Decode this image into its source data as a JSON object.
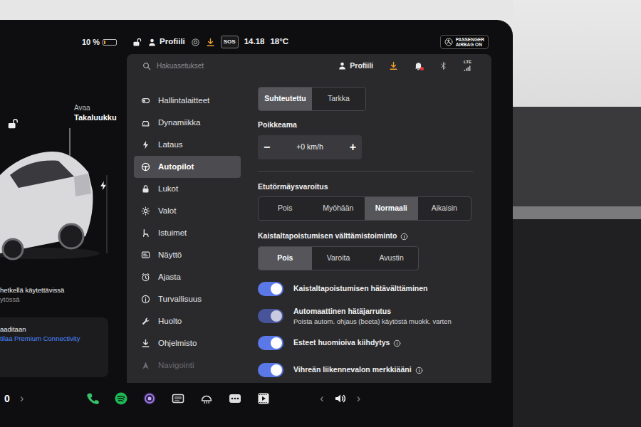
{
  "status_bar": {
    "battery": "10 %",
    "battery_level": 0.1,
    "profile": "Profiili",
    "sos": "SOS",
    "time": "14.18",
    "temperature": "18°C",
    "airbag": {
      "top": "PASSENGER",
      "bottom": "AIRBAG ON"
    }
  },
  "car_panel": {
    "trunk": {
      "top": "Avaa",
      "bottom": "Takaluukku"
    },
    "status": [
      "hetkellä käytettävissä",
      "ytössä"
    ],
    "connectivity": {
      "text": "aaditaan",
      "link": "tilaa Premium Connectivity"
    }
  },
  "settings": {
    "search": {
      "placeholder": "Hakuasetukset"
    },
    "profile": "Profiili",
    "unread": true,
    "network": "LTE",
    "nav": [
      {
        "label": "Hallintalaitteet",
        "selected": false,
        "dimmed": false
      },
      {
        "label": "Dynamiikka",
        "selected": false,
        "dimmed": false
      },
      {
        "label": "Lataus",
        "selected": false,
        "dimmed": false
      },
      {
        "label": "Autopilot",
        "selected": true,
        "dimmed": false
      },
      {
        "label": "Lukot",
        "selected": false,
        "dimmed": false
      },
      {
        "label": "Valot",
        "selected": false,
        "dimmed": false
      },
      {
        "label": "Istuimet",
        "selected": false,
        "dimmed": false
      },
      {
        "label": "Näyttö",
        "selected": false,
        "dimmed": false
      },
      {
        "label": "Ajasta",
        "selected": false,
        "dimmed": false
      },
      {
        "label": "Turvallisuus",
        "selected": false,
        "dimmed": false
      },
      {
        "label": "Huolto",
        "selected": false,
        "dimmed": false
      },
      {
        "label": "Ohjelmisto",
        "selected": false,
        "dimmed": false
      },
      {
        "label": "Navigointi",
        "selected": false,
        "dimmed": true
      }
    ],
    "steering_mode": {
      "options": [
        {
          "label": "Suhteutettu",
          "selected": true
        },
        {
          "label": "Tarkka",
          "selected": false
        }
      ]
    },
    "offset": {
      "label": "Poikkeama",
      "value": "+0 km/h",
      "decrease": "−",
      "increase": "+"
    },
    "forward_collision": {
      "label": "Etutörmäysvaroitus",
      "options": [
        {
          "label": "Pois",
          "selected": false
        },
        {
          "label": "Myöhään",
          "selected": false
        },
        {
          "label": "Normaali",
          "selected": true
        },
        {
          "label": "Aikaisin",
          "selected": false
        }
      ]
    },
    "lane_departure": {
      "label": "Kaistaltapoistumisen välttämistoiminto",
      "info": true,
      "options": [
        {
          "label": "Pois",
          "selected": true
        },
        {
          "label": "Varoita",
          "selected": false
        },
        {
          "label": "Avustin",
          "selected": false
        }
      ]
    },
    "toggles": [
      {
        "label": "Kaistaltapoistumisen hätävälttäminen",
        "on": true,
        "disabled": false,
        "info": false
      },
      {
        "label": "Automaattinen hätäjarrutus",
        "subtitle": "Poista autom. ohjaus (beeta) käytöstä muokk. varten",
        "on": true,
        "disabled": true,
        "info": false
      },
      {
        "label": "Esteet huomioiva kiihdytys",
        "on": true,
        "disabled": false,
        "info": true
      },
      {
        "label": "Vihreän liikennevalon merkkiääni",
        "on": true,
        "disabled": false,
        "info": true
      }
    ]
  },
  "dock": {
    "reading": "0",
    "next": "›",
    "volume_prev": "‹",
    "volume_next": "›"
  }
}
